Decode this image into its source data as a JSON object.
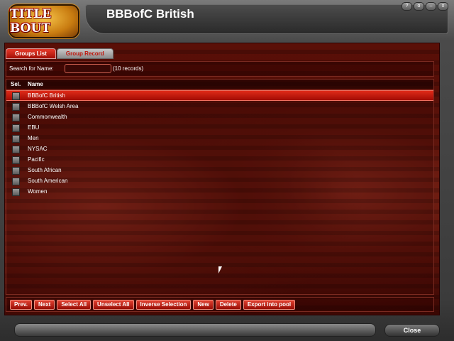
{
  "app": {
    "logo_text": "TITLE BOUT",
    "title": "BBBofC British",
    "window_controls": [
      "?",
      "o",
      "–",
      "x"
    ]
  },
  "tabs": [
    {
      "label": "Groups List",
      "active": true
    },
    {
      "label": "Group Record",
      "active": false
    }
  ],
  "search": {
    "label": "Search for Name:",
    "value": "",
    "placeholder": "",
    "record_count": "(10 records)"
  },
  "list": {
    "headers": {
      "sel": "Sel.",
      "name": "Name"
    },
    "rows": [
      {
        "name": "BBBofC British",
        "selected": true
      },
      {
        "name": "BBBofC Welsh Area",
        "selected": false
      },
      {
        "name": "Commonwealth",
        "selected": false
      },
      {
        "name": "EBU",
        "selected": false
      },
      {
        "name": "Men",
        "selected": false
      },
      {
        "name": "NYSAC",
        "selected": false
      },
      {
        "name": "Pacific",
        "selected": false
      },
      {
        "name": "South African",
        "selected": false
      },
      {
        "name": "South American",
        "selected": false
      },
      {
        "name": "Women",
        "selected": false
      }
    ]
  },
  "buttons": {
    "prev": "Prev.",
    "next": "Next",
    "select_all": "Select All",
    "unselect_all": "Unselect All",
    "inverse_selection": "Inverse Selection",
    "new": "New",
    "delete": "Delete",
    "export": "Export into pool"
  },
  "footer": {
    "close": "Close"
  },
  "colors": {
    "accent": "#c0150a",
    "panel": "#5a0f07"
  }
}
